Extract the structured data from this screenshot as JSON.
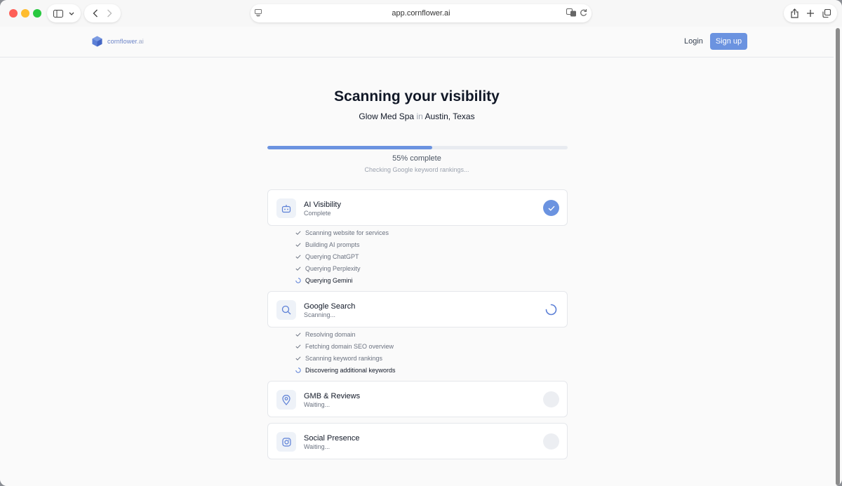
{
  "browser": {
    "url": "app.cornflower.ai"
  },
  "header": {
    "logo_name": "cornflower",
    "logo_suffix": ".ai",
    "login_label": "Login",
    "signup_label": "Sign up"
  },
  "main": {
    "title": "Scanning your visibility",
    "business_name": "Glow Med Spa",
    "in_word": "in",
    "location": "Austin, Texas",
    "progress_percent": 55,
    "progress_label": "55% complete",
    "progress_status": "Checking Google keyword rankings..."
  },
  "sections": [
    {
      "title": "AI Visibility",
      "status": "Complete",
      "state": "done",
      "icon": "robot-icon",
      "steps": [
        {
          "label": "Scanning website for services",
          "state": "done"
        },
        {
          "label": "Building AI prompts",
          "state": "done"
        },
        {
          "label": "Querying ChatGPT",
          "state": "done"
        },
        {
          "label": "Querying Perplexity",
          "state": "done"
        },
        {
          "label": "Querying Gemini",
          "state": "active"
        }
      ]
    },
    {
      "title": "Google Search",
      "status": "Scanning...",
      "state": "scanning",
      "icon": "search-icon",
      "steps": [
        {
          "label": "Resolving domain",
          "state": "done"
        },
        {
          "label": "Fetching domain SEO overview",
          "state": "done"
        },
        {
          "label": "Scanning keyword rankings",
          "state": "done"
        },
        {
          "label": "Discovering additional keywords",
          "state": "active"
        }
      ]
    },
    {
      "title": "GMB & Reviews",
      "status": "Waiting...",
      "state": "waiting",
      "icon": "map-pin-icon",
      "steps": []
    },
    {
      "title": "Social Presence",
      "status": "Waiting...",
      "state": "waiting",
      "icon": "instagram-icon",
      "steps": []
    }
  ],
  "colors": {
    "accent": "#6b93e0",
    "track": "#e8ebf0",
    "waiting": "#eceef2"
  }
}
